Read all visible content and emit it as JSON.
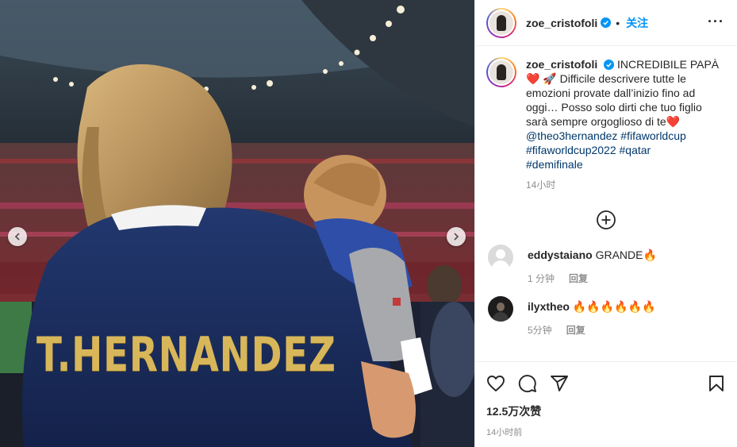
{
  "media": {
    "jersey_text": "T.HERNANDEZ",
    "prev_icon": "chevron-left-icon",
    "next_icon": "chevron-right-icon"
  },
  "header": {
    "username": "zoe_cristofoli",
    "follow_label": "关注",
    "more_icon": "more-horizontal-icon",
    "more_label": "···"
  },
  "caption": {
    "username": "zoe_cristofoli",
    "text_line1": "INCREDIBILE PAPÀ",
    "text_body": "Difficile descrivere tutte le emozioni provate dall’inizio fino ad oggi… Posso solo dirti che tuo figlio sarà sempre orgoglioso di te",
    "hashtags_line1": "@theo3hernandez #fifaworldcup",
    "hashtags_line2": "#fifaworldcup2022 #qatar",
    "hashtags_line3": "#demifinale",
    "time": "14小时"
  },
  "load_more_icon": "plus-circle-icon",
  "comments": [
    {
      "username": "eddystaiano",
      "text": "GRANDE🔥",
      "time": "1 分钟",
      "reply": "回复"
    },
    {
      "username": "ilyxtheo",
      "text": "🔥🔥🔥🔥🔥🔥",
      "time": "5分钟",
      "reply": "回复"
    }
  ],
  "actions": {
    "like_icon": "heart-icon",
    "comment_icon": "comment-icon",
    "share_icon": "share-icon",
    "save_icon": "bookmark-icon"
  },
  "likes": "12.5万次赞",
  "post_time": "14小时前",
  "colors": {
    "accent": "#0095f6",
    "jersey": "#1c2f6b",
    "gold": "#d8b65a",
    "hashtag": "#00376b"
  }
}
